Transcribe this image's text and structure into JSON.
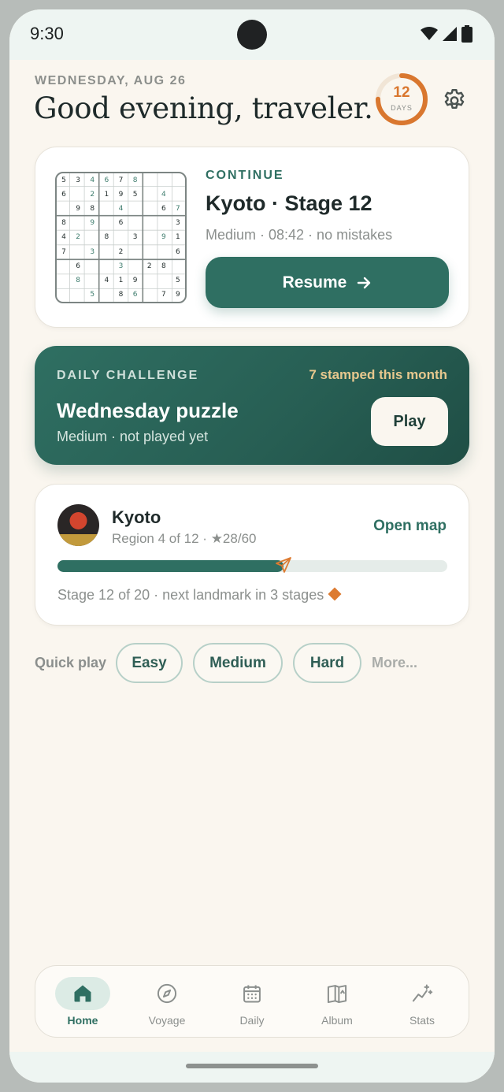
{
  "status_bar": {
    "time": "9:30"
  },
  "header": {
    "date": "WEDNESDAY, AUG 26",
    "greeting": "Good evening, traveler.",
    "streak_count": "12",
    "streak_label": "DAYS",
    "streak_progress": 0.75
  },
  "continue_card": {
    "label": "CONTINUE",
    "title": "Kyoto · Stage 12",
    "meta": "Medium · 08:42 · no mistakes",
    "resume_label": "Resume",
    "mini_grid": [
      [
        "5",
        "3",
        "4",
        "6",
        "7",
        "8",
        "",
        "",
        ""
      ],
      [
        "6",
        "",
        "2",
        "1",
        "9",
        "5",
        "",
        "4",
        ""
      ],
      [
        "",
        "9",
        "8",
        "",
        "4",
        "",
        "",
        "6",
        "7"
      ],
      [
        "8",
        "",
        "9",
        "",
        "6",
        "",
        "",
        "",
        "3"
      ],
      [
        "4",
        "2",
        "",
        "8",
        "",
        "3",
        "",
        "9",
        "1"
      ],
      [
        "7",
        "",
        "3",
        "",
        "2",
        "",
        "",
        "",
        "6"
      ],
      [
        "",
        "6",
        "",
        "",
        "3",
        "",
        "2",
        "8",
        ""
      ],
      [
        "",
        "8",
        "",
        "4",
        "1",
        "9",
        "",
        "",
        "5"
      ],
      [
        "",
        "",
        "5",
        "",
        "8",
        "6",
        "",
        "7",
        "9"
      ]
    ],
    "mini_grid_user": [
      [
        0,
        0,
        1,
        1,
        0,
        1,
        0,
        0,
        0
      ],
      [
        0,
        0,
        1,
        0,
        0,
        0,
        0,
        1,
        0
      ],
      [
        0,
        0,
        0,
        0,
        1,
        0,
        0,
        0,
        1
      ],
      [
        0,
        0,
        1,
        0,
        0,
        0,
        0,
        0,
        0
      ],
      [
        0,
        1,
        0,
        0,
        0,
        0,
        0,
        1,
        0
      ],
      [
        0,
        0,
        1,
        0,
        0,
        0,
        0,
        0,
        0
      ],
      [
        0,
        0,
        0,
        0,
        1,
        0,
        0,
        0,
        0
      ],
      [
        0,
        1,
        0,
        0,
        0,
        0,
        0,
        0,
        0
      ],
      [
        0,
        0,
        1,
        0,
        0,
        1,
        0,
        0,
        0
      ]
    ]
  },
  "daily_challenge": {
    "label": "DAILY CHALLENGE",
    "stamped": "7 stamped this month",
    "title": "Wednesday puzzle",
    "meta": "Medium · not played yet",
    "play_label": "Play"
  },
  "region_card": {
    "name": "Kyoto",
    "meta": "Region 4 of 12 · ★28/60",
    "open_map_label": "Open map",
    "progress": 0.58,
    "stage_text": "Stage 12 of 20 · next landmark in 3 stages"
  },
  "quick_play": {
    "label": "Quick play",
    "chips": [
      "Easy",
      "Medium",
      "Hard"
    ],
    "more_label": "More..."
  },
  "bottom_nav": {
    "items": [
      {
        "label": "Home",
        "icon": "home-icon",
        "active": true
      },
      {
        "label": "Voyage",
        "icon": "compass-icon",
        "active": false
      },
      {
        "label": "Daily",
        "icon": "calendar-icon",
        "active": false
      },
      {
        "label": "Album",
        "icon": "album-icon",
        "active": false
      },
      {
        "label": "Stats",
        "icon": "stats-icon",
        "active": false
      }
    ]
  },
  "colors": {
    "accent": "#2f6f62",
    "streak": "#d9772f",
    "background": "#faf6ef"
  }
}
